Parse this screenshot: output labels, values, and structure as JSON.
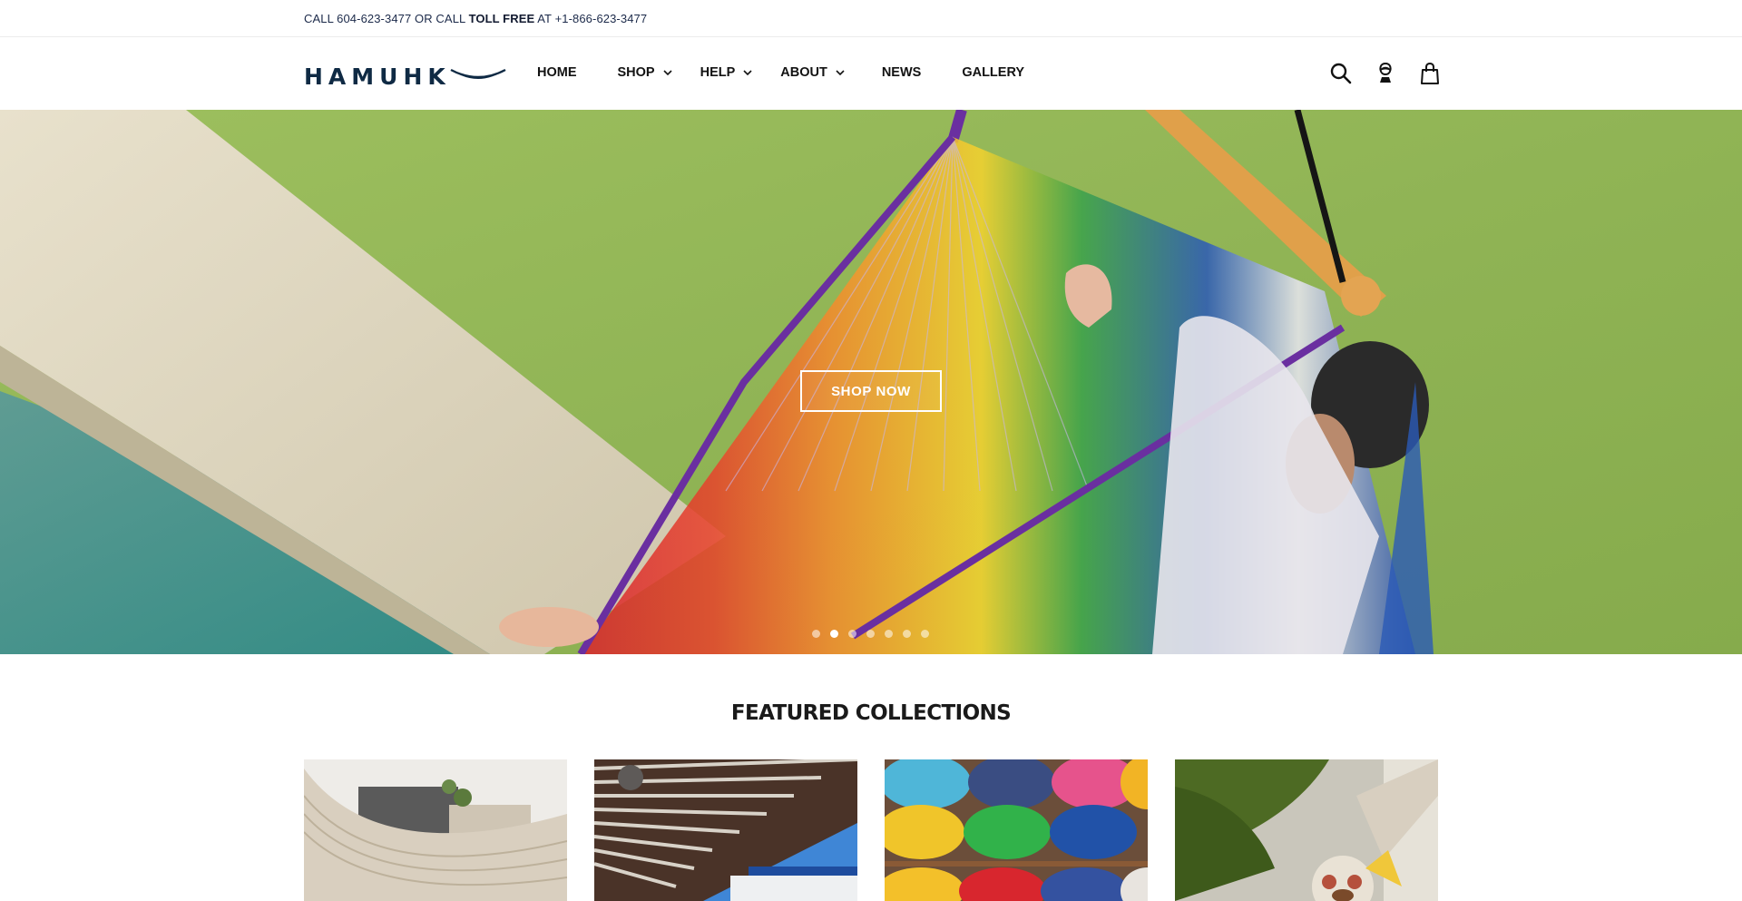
{
  "announcement": {
    "prefix": "CALL 604-623-3477 OR CALL",
    "bold": "TOLL FREE",
    "suffix": "AT +1-866-623-3477"
  },
  "brand": {
    "name": "HAMUHK",
    "color": "#0f2a44"
  },
  "nav": {
    "items": [
      {
        "label": "HOME",
        "dropdown": false
      },
      {
        "label": "SHOP",
        "dropdown": true
      },
      {
        "label": "HELP",
        "dropdown": true
      },
      {
        "label": "ABOUT",
        "dropdown": true
      },
      {
        "label": "NEWS",
        "dropdown": false
      },
      {
        "label": "GALLERY",
        "dropdown": false
      }
    ]
  },
  "header_icons": [
    "search-icon",
    "account-icon",
    "cart-icon"
  ],
  "hero": {
    "cta_label": "SHOP NOW",
    "slide_count": 7,
    "active_slide": 2
  },
  "featured": {
    "title": "FEATURED COLLECTIONS",
    "cards": [
      {
        "name": "collection-card-1"
      },
      {
        "name": "collection-card-2"
      },
      {
        "name": "collection-card-3"
      },
      {
        "name": "collection-card-4"
      }
    ]
  }
}
